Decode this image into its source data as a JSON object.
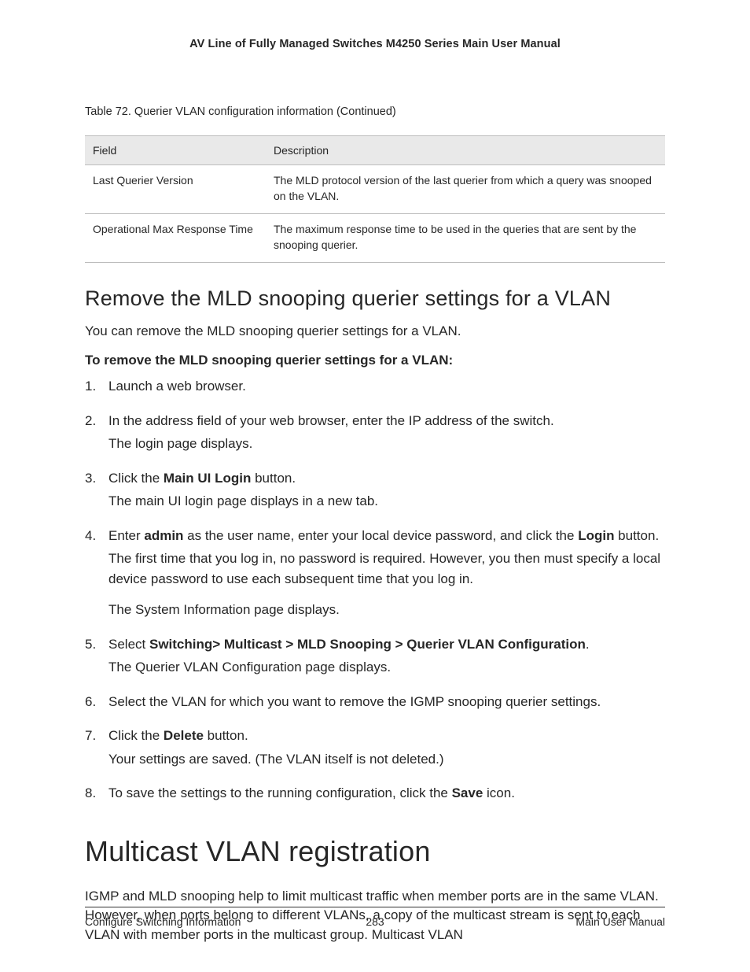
{
  "header": {
    "title": "AV Line of Fully Managed Switches M4250 Series Main User Manual"
  },
  "table": {
    "caption": "Table 72. Querier VLAN configuration information (Continued)",
    "columns": [
      "Field",
      "Description"
    ],
    "rows": [
      {
        "field": "Last Querier Version",
        "desc": "The MLD protocol version of the last querier from which a query was snooped on the VLAN."
      },
      {
        "field": "Operational Max Response Time",
        "desc": "The maximum response time to be used in the queries that are sent by the snooping querier."
      }
    ]
  },
  "section1": {
    "heading": "Remove the MLD snooping querier settings for a VLAN",
    "intro": "You can remove the MLD snooping querier settings for a VLAN.",
    "lead": "To remove the MLD snooping querier settings for a VLAN:",
    "steps": {
      "s1": "Launch a web browser.",
      "s2a": "In the address field of your web browser, enter the IP address of the switch.",
      "s2b": "The login page displays.",
      "s3a_pre": "Click the ",
      "s3a_bold": "Main UI Login",
      "s3a_post": " button.",
      "s3b": "The main UI login page displays in a new tab.",
      "s4a_pre": "Enter ",
      "s4a_bold1": "admin",
      "s4a_mid": " as the user name, enter your local device password, and click the ",
      "s4a_bold2": "Login",
      "s4a_post": " button.",
      "s4b": "The first time that you log in, no password is required. However, you then must specify a local device password to use each subsequent time that you log in.",
      "s4c": "The System Information page displays.",
      "s5a_pre": "Select ",
      "s5a_bold": "Switching> Multicast > MLD Snooping > Querier VLAN Configuration",
      "s5a_post": ".",
      "s5b": "The Querier VLAN Configuration page displays.",
      "s6": "Select the VLAN for which you want to remove the IGMP snooping querier settings.",
      "s7a_pre": "Click the ",
      "s7a_bold": "Delete",
      "s7a_post": " button.",
      "s7b": "Your settings are saved. (The VLAN itself is not deleted.)",
      "s8_pre": "To save the settings to the running configuration, click the ",
      "s8_bold": "Save",
      "s8_post": " icon."
    }
  },
  "section2": {
    "heading": "Multicast VLAN registration",
    "para": "IGMP and MLD snooping help to limit multicast traffic when member ports are in the same VLAN. However, when ports belong to different VLANs, a copy of the multicast stream is sent to each VLAN with member ports in the multicast group. Multicast VLAN"
  },
  "footer": {
    "left": "Configure Switching Information",
    "center": "283",
    "right": "Main User Manual"
  }
}
